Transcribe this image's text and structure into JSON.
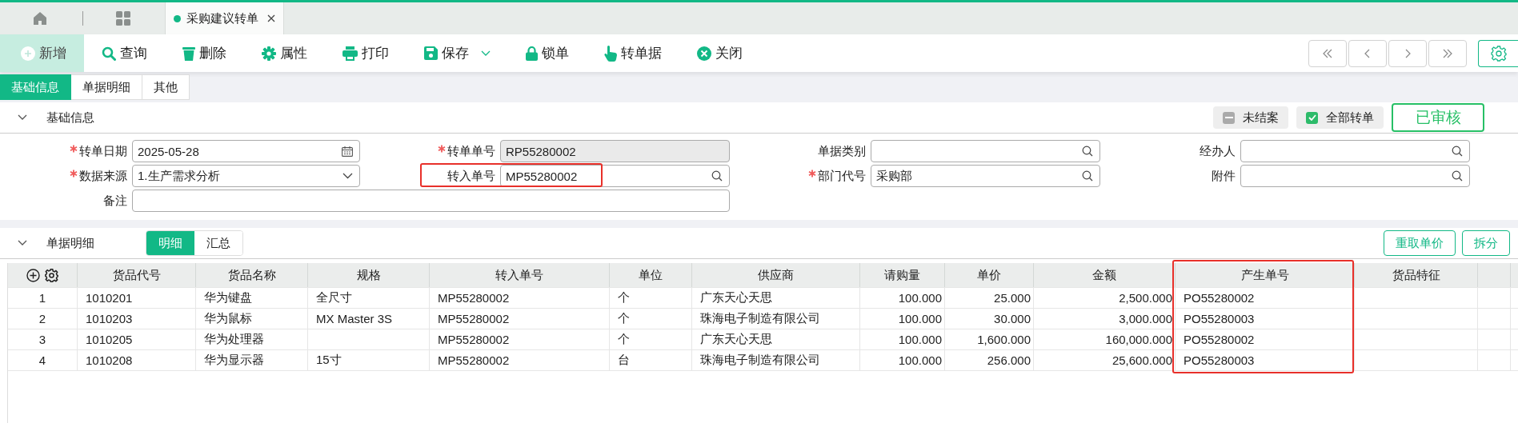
{
  "tab_bar": {
    "tabs": [
      {
        "label": "采购建议转单",
        "selected": true,
        "closable": true
      }
    ]
  },
  "toolbar": {
    "buttons": [
      {
        "label": "新增",
        "kind": "add",
        "active": true
      },
      {
        "label": "查询",
        "kind": "search",
        "active": false
      },
      {
        "label": "删除",
        "kind": "delete",
        "active": false
      },
      {
        "label": "属性",
        "kind": "gear",
        "active": false
      },
      {
        "label": "打印",
        "kind": "print",
        "active": false
      },
      {
        "label": "保存",
        "kind": "save",
        "active": false,
        "dropdown": true
      },
      {
        "label": "锁单",
        "kind": "lock",
        "active": false
      },
      {
        "label": "转单据",
        "kind": "hand",
        "active": false
      },
      {
        "label": "关闭",
        "kind": "close",
        "active": false
      }
    ]
  },
  "page_tabs": [
    {
      "label": "基础信息",
      "selected": true
    },
    {
      "label": "单据明细",
      "selected": false
    },
    {
      "label": "其他",
      "selected": false
    }
  ],
  "basic_section": {
    "title": "基础信息",
    "expanded": true,
    "flags": [
      {
        "label": "未结案",
        "kind": "minus"
      },
      {
        "label": "全部转单",
        "kind": "check"
      }
    ],
    "stamp": "已审核",
    "fields": [
      {
        "label": "转单日期",
        "required": true,
        "kind": "date",
        "value": "2025-05-28"
      },
      {
        "label": "转单单号",
        "required": true,
        "kind": "readonly",
        "value": "RP55280002"
      },
      {
        "label": "单据类别",
        "required": false,
        "kind": "search"
      },
      {
        "label": "经办人",
        "required": false,
        "kind": "search"
      },
      {
        "label": "数据来源",
        "required": true,
        "kind": "select",
        "value": "1.生产需求分析"
      },
      {
        "label": "转入单号",
        "required": false,
        "kind": "search",
        "value": "MP55280002",
        "highlighted": true
      },
      {
        "label": "部门代号",
        "required": true,
        "kind": "search",
        "value": "采购部"
      },
      {
        "label": "附件",
        "required": false,
        "kind": "search"
      },
      {
        "label": "备注",
        "required": false,
        "kind": "wide"
      }
    ]
  },
  "detail_section": {
    "title": "单据明细",
    "expanded": true,
    "view_tabs": [
      {
        "label": "明细",
        "selected": true
      },
      {
        "label": "汇总",
        "selected": false
      }
    ],
    "buttons": [
      "重取单价",
      "拆分"
    ],
    "table": {
      "columns": [
        {
          "label": "货品代号",
          "kind": "text"
        },
        {
          "label": "货品名称",
          "kind": "text"
        },
        {
          "label": "规格",
          "kind": "text"
        },
        {
          "label": "转入单号",
          "kind": "text"
        },
        {
          "label": "单位",
          "kind": "text"
        },
        {
          "label": "供应商",
          "kind": "text"
        },
        {
          "label": "请购量",
          "kind": "number"
        },
        {
          "label": "单价",
          "kind": "number"
        },
        {
          "label": "金额",
          "kind": "number"
        },
        {
          "label": "产生单号",
          "kind": "text",
          "highlighted": true
        },
        {
          "label": "货品特征",
          "kind": "text"
        }
      ],
      "rows": [
        {
          "index": "1",
          "cells": [
            "1010201",
            "华为键盘",
            "全尺寸",
            "MP55280002",
            "个",
            "广东天心天思",
            "100.000",
            "25.000",
            "2,500.000",
            "PO55280002",
            ""
          ]
        },
        {
          "index": "2",
          "cells": [
            "1010203",
            "华为鼠标",
            "MX Master 3S",
            "MP55280002",
            "个",
            "珠海电子制造有限公司",
            "100.000",
            "30.000",
            "3,000.000",
            "PO55280003",
            ""
          ]
        },
        {
          "index": "3",
          "cells": [
            "1010205",
            "华为处理器",
            "",
            "MP55280002",
            "个",
            "广东天心天思",
            "100.000",
            "1,600.000",
            "160,000.000",
            "PO55280002",
            ""
          ]
        },
        {
          "index": "4",
          "cells": [
            "1010208",
            "华为显示器",
            "15寸",
            "MP55280002",
            "台",
            "珠海电子制造有限公司",
            "100.000",
            "256.000",
            "25,600.000",
            "PO55280003",
            ""
          ]
        }
      ]
    }
  }
}
